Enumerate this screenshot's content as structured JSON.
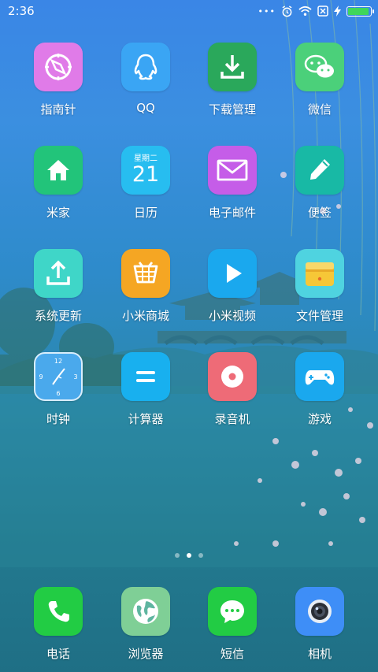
{
  "status_bar": {
    "time": "2:36",
    "dots": "•••"
  },
  "calendar": {
    "weekday": "星期二",
    "day": "21"
  },
  "clock_numbers": [
    "12",
    "3",
    "6",
    "9"
  ],
  "apps": [
    {
      "label": "指南针",
      "icon": "compass-icon",
      "color": "#e07be8"
    },
    {
      "label": "QQ",
      "icon": "qq-penguin-icon",
      "color": "#3aa5f4"
    },
    {
      "label": "下载管理",
      "icon": "download-icon",
      "color": "#2aa85b"
    },
    {
      "label": "微信",
      "icon": "wechat-icon",
      "color": "#4bd07a"
    },
    {
      "label": "米家",
      "icon": "home-icon",
      "color": "#22c47a"
    },
    {
      "label": "日历",
      "icon": "calendar-icon",
      "color": "#27bdf0"
    },
    {
      "label": "电子邮件",
      "icon": "mail-icon",
      "color": "#c55de8"
    },
    {
      "label": "便签",
      "icon": "pencil-icon",
      "color": "#18b9a5"
    },
    {
      "label": "系统更新",
      "icon": "upload-icon",
      "color": "#3fd6c8"
    },
    {
      "label": "小米商城",
      "icon": "basket-icon",
      "color": "#f5a623"
    },
    {
      "label": "小米视频",
      "icon": "play-icon",
      "color": "#1aa8ee"
    },
    {
      "label": "文件管理",
      "icon": "folder-icon",
      "color": "#f6c737"
    },
    {
      "label": "时钟",
      "icon": "clock-icon",
      "color": "#4aa9ec"
    },
    {
      "label": "计算器",
      "icon": "calculator-icon",
      "color": "#18b0ef"
    },
    {
      "label": "录音机",
      "icon": "recorder-icon",
      "color": "#ee6b77"
    },
    {
      "label": "游戏",
      "icon": "gamepad-icon",
      "color": "#1aa8ee"
    }
  ],
  "page_indicator": {
    "count": 3,
    "active": 1
  },
  "dock": [
    {
      "label": "电话",
      "icon": "phone-icon",
      "color": "#22cc44"
    },
    {
      "label": "浏览器",
      "icon": "globe-icon",
      "color": "#7fcf96"
    },
    {
      "label": "短信",
      "icon": "message-icon",
      "color": "#22cc44"
    },
    {
      "label": "相机",
      "icon": "camera-icon",
      "color": "#3e8ef7"
    }
  ]
}
